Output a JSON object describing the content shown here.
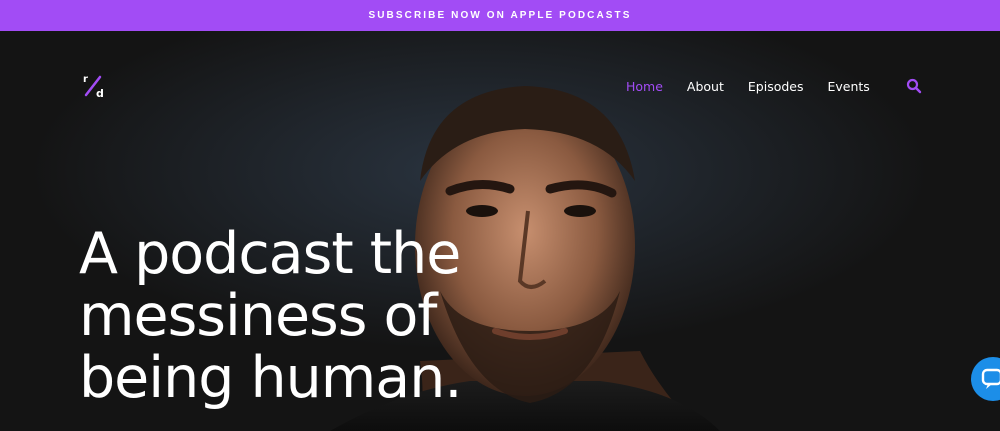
{
  "announcement": {
    "text": "SUBSCRIBE NOW ON APPLE PODCASTS"
  },
  "logo": {
    "letters": "r/d"
  },
  "nav": {
    "items": [
      {
        "label": "Home",
        "active": true
      },
      {
        "label": "About",
        "active": false
      },
      {
        "label": "Episodes",
        "active": false
      },
      {
        "label": "Events",
        "active": false
      }
    ]
  },
  "hero": {
    "headline_lines": [
      "A podcast the",
      "messiness of",
      "being human."
    ]
  },
  "icons": {
    "search": "search-icon",
    "chat": "chat-bubble-icon"
  },
  "colors": {
    "accent": "#a24cf5",
    "background": "#141414",
    "chat": "#1c8ee8"
  }
}
